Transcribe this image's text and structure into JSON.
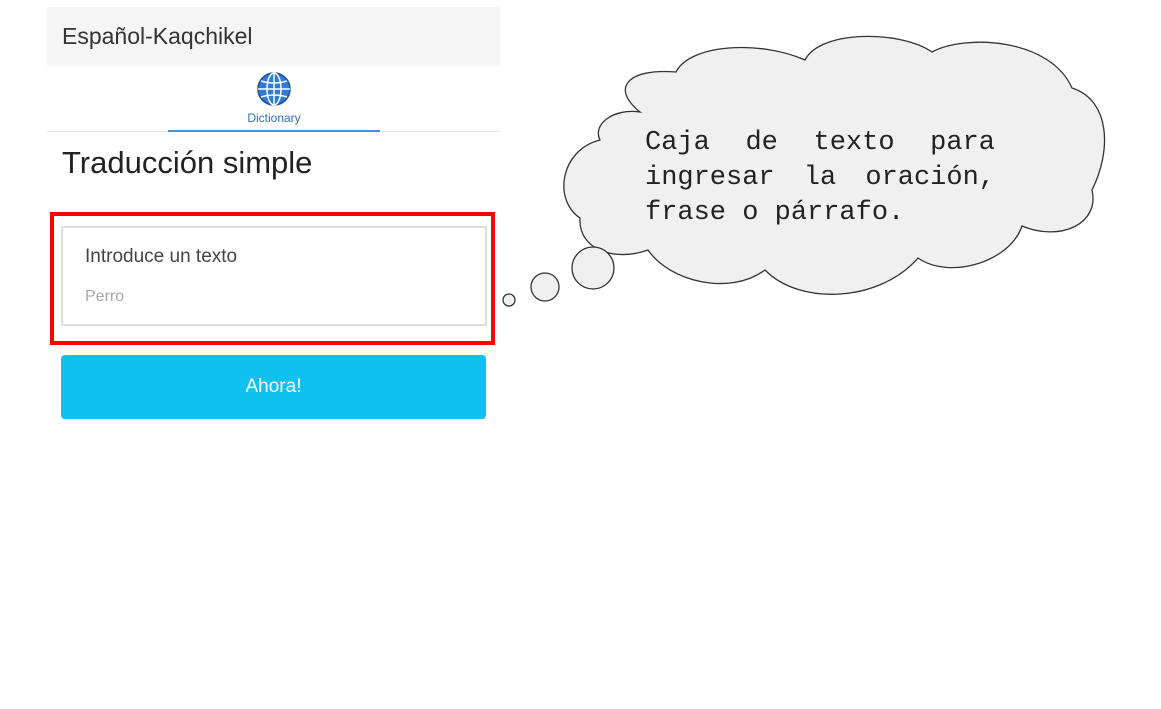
{
  "app": {
    "title": "Español-Kaqchikel"
  },
  "tabs": [
    {
      "label": "Dictionary",
      "icon": "globe-icon",
      "active": true
    }
  ],
  "main": {
    "title": "Traducción simple",
    "input": {
      "label": "Introduce un texto",
      "placeholder": "Perro",
      "value": ""
    },
    "submit_label": "Ahora!"
  },
  "annotation": {
    "text": "Caja de texto para ingresar la oración, frase o párrafo."
  },
  "colors": {
    "accent": "#10c0ee",
    "tab_underline": "#4a90d9",
    "highlight": "#ff0000",
    "callout_fill": "#f0f0f0"
  }
}
